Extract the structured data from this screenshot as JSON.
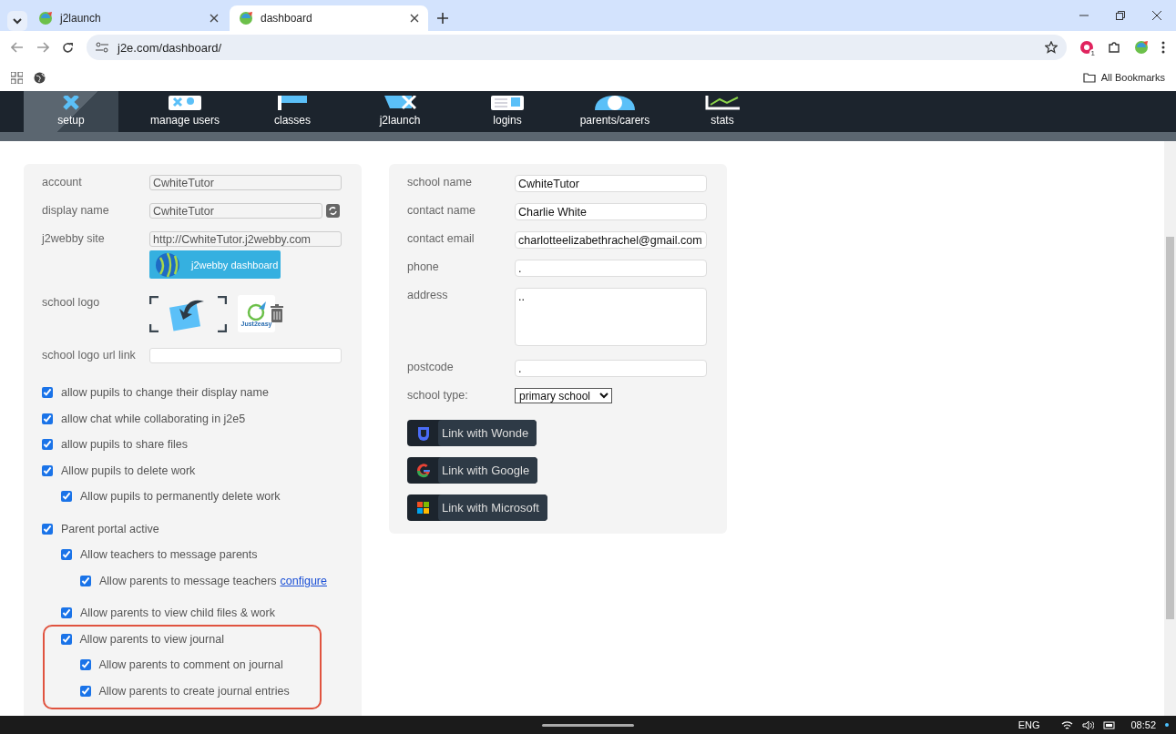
{
  "browser": {
    "tabs": [
      {
        "title": "j2launch",
        "selected": false
      },
      {
        "title": "dashboard",
        "selected": true
      }
    ],
    "address": "j2e.com/dashboard/",
    "extension_badge": "1",
    "bookmarks_label": "All Bookmarks"
  },
  "nav": [
    {
      "label": "setup",
      "selected": true
    },
    {
      "label": "manage users",
      "selected": false
    },
    {
      "label": "classes",
      "selected": false
    },
    {
      "label": "j2launch",
      "selected": false
    },
    {
      "label": "logins",
      "selected": false
    },
    {
      "label": "parents/carers",
      "selected": false
    },
    {
      "label": "stats",
      "selected": false
    }
  ],
  "account": {
    "fields": [
      {
        "label": "account",
        "value": "CwhiteTutor"
      },
      {
        "label": "display name",
        "value": "CwhiteTutor"
      },
      {
        "label": "j2webby site",
        "value": "http://CwhiteTutor.j2webby.com"
      }
    ],
    "webby_button": "j2webby dashboard",
    "logo_label": "school logo",
    "logo_text": "Just2easy",
    "logo_url_label": "school logo url link"
  },
  "options": [
    {
      "label": "allow pupils to change their display name",
      "checked": true,
      "highlighted": false
    },
    {
      "label": "allow chat while collaborating in j2e5",
      "checked": true,
      "highlighted": false
    },
    {
      "label": "allow pupils to share files",
      "checked": true,
      "highlighted": false
    },
    {
      "label": "Allow pupils to delete work",
      "checked": true,
      "highlighted": false,
      "children": [
        {
          "label": "Allow pupils to permanently delete work",
          "checked": true,
          "highlighted": false
        }
      ]
    },
    {
      "label": "Parent portal active",
      "checked": true,
      "highlighted": false,
      "children": [
        {
          "label": "Allow teachers to message parents",
          "checked": true,
          "highlighted": false,
          "children": [
            {
              "label": "Allow parents to message teachers",
              "link": "configure",
              "checked": true,
              "highlighted": false
            }
          ]
        },
        {
          "label": "Allow parents to view child files & work",
          "checked": true,
          "highlighted": false
        },
        {
          "label": "Allow parents to view journal",
          "checked": true,
          "highlighted": true,
          "children": [
            {
              "label": "Allow parents to comment on journal",
              "checked": true,
              "highlighted": false
            },
            {
              "label": "Allow parents to create journal entries",
              "checked": true,
              "highlighted": false
            }
          ]
        }
      ]
    }
  ],
  "school": {
    "fields": [
      {
        "label": "school name",
        "value": "CwhiteTutor",
        "kind": "text"
      },
      {
        "label": "contact name",
        "value": "Charlie White",
        "kind": "text"
      },
      {
        "label": "contact email",
        "value": "charlotteelizabethrachel@gmail.com",
        "kind": "text"
      },
      {
        "label": "phone",
        "value": ".",
        "kind": "text"
      },
      {
        "label": "address",
        "value": "..",
        "kind": "textarea"
      },
      {
        "label": "postcode",
        "value": ".",
        "kind": "text"
      },
      {
        "label": "school type:",
        "value": "primary school",
        "kind": "select"
      }
    ],
    "link_buttons": [
      {
        "label": "Link with Wonde",
        "kind": "wonde"
      },
      {
        "label": "Link with Google",
        "kind": "google"
      },
      {
        "label": "Link with Microsoft",
        "kind": "microsoft"
      }
    ]
  },
  "taskbar": {
    "language": "ENG",
    "time": "08:52"
  }
}
